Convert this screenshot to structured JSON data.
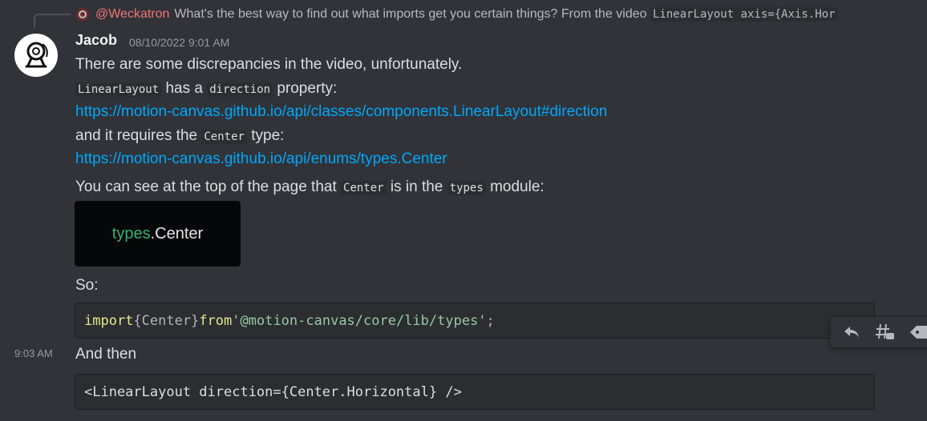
{
  "reply": {
    "mention": "@Weckatron",
    "text": "What's the best way to find out what imports get you certain things? From the video",
    "code": "LinearLayout axis={Axis.Hor"
  },
  "message": {
    "author": "Jacob",
    "timestamp": "08/10/2022 9:01 AM",
    "line1": "There are some discrepancies in the video, unfortunately.",
    "line2_code1": "LinearLayout",
    "line2_text1": "has a",
    "line2_code2": "direction",
    "line2_text2": "property:",
    "link1": "https://motion-canvas.github.io/api/classes/components.LinearLayout#direction",
    "line3_text1": "and it requires the",
    "line3_code": "Center",
    "line3_text2": "type:",
    "link2": "https://motion-canvas.github.io/api/enums/types.Center",
    "line4_text1": "You can see at the top of the page that",
    "line4_code1": "Center",
    "line4_text2": "is in the",
    "line4_code2": "types",
    "line4_text3": "module:",
    "image": {
      "part1": "types",
      "part2": ".Center"
    },
    "so": "So:",
    "code1": {
      "kw_import": "import",
      "braces": "{Center}",
      "kw_from": "from",
      "module": "'@motion-canvas/core/lib/types'",
      "semi": ";"
    }
  },
  "followup": {
    "time": "9:03 AM",
    "text": "And then",
    "code": "<LinearLayout direction={Center.Horizontal} />"
  },
  "toolbar": {
    "icons": [
      "reply-icon",
      "thread-icon",
      "tag-icon"
    ]
  },
  "colors": {
    "background": "#313338",
    "link": "#00a8fc",
    "mention": "#f27474",
    "keyword": "#e6e88a",
    "string": "#98c9a5"
  }
}
